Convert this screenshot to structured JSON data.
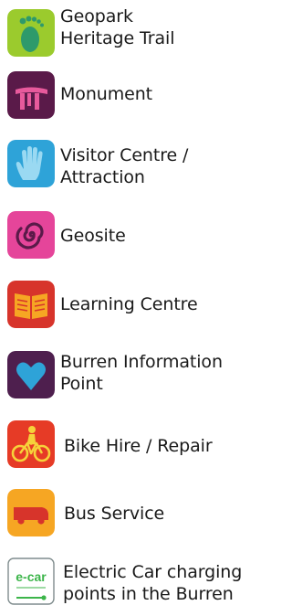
{
  "legend": {
    "items": [
      {
        "id": "geopark-heritage-trail",
        "icon": "footprint-icon",
        "color": "#9BCB2D",
        "label_lines": [
          "Geopark",
          "Heritage Trail"
        ]
      },
      {
        "id": "monument",
        "icon": "dolmen-icon",
        "color": "#5A1A49",
        "label_lines": [
          "Monument"
        ]
      },
      {
        "id": "visitor-centre-attraction",
        "icon": "hand-icon",
        "color": "#2EA3D8",
        "label_lines": [
          "Visitor Centre /",
          "Attraction"
        ]
      },
      {
        "id": "geosite",
        "icon": "spiral-icon",
        "color": "#E5459A",
        "label_lines": [
          "Geosite"
        ]
      },
      {
        "id": "learning-centre",
        "icon": "book-icon",
        "color": "#D7342B",
        "label_lines": [
          "Learning Centre"
        ]
      },
      {
        "id": "burren-information-point",
        "icon": "heart-icon",
        "color": "#4E1F4E",
        "label_lines": [
          "Burren Information",
          "Point"
        ]
      },
      {
        "id": "bike-hire-repair",
        "icon": "cyclist-icon",
        "color": "#E63B26",
        "label_lines": [
          "Bike Hire / Repair"
        ]
      },
      {
        "id": "bus-service",
        "icon": "bus-icon",
        "color": "#F6A623",
        "label_lines": [
          "Bus Service"
        ]
      },
      {
        "id": "electric-car-charging",
        "icon": "ecar-charging-icon",
        "color": "#3CB54A",
        "icon_text": "e-car",
        "label_lines": [
          "Electric Car charging",
          "points in the Burren"
        ]
      }
    ]
  }
}
